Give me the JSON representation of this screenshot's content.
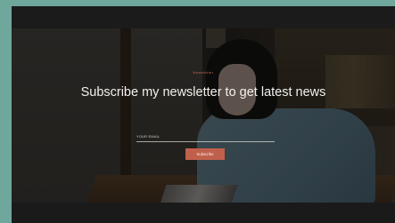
{
  "newsletter": {
    "eyebrow": "Newsletter",
    "headline": "Subscribe my newsletter to get latest news",
    "email_label": "YOUR EMAIL",
    "email_value": "",
    "subscribe_label": "Subscribe"
  },
  "colors": {
    "accent": "#c0604c",
    "page_background": "#6fa79c",
    "bar": "#1b1b1b"
  }
}
